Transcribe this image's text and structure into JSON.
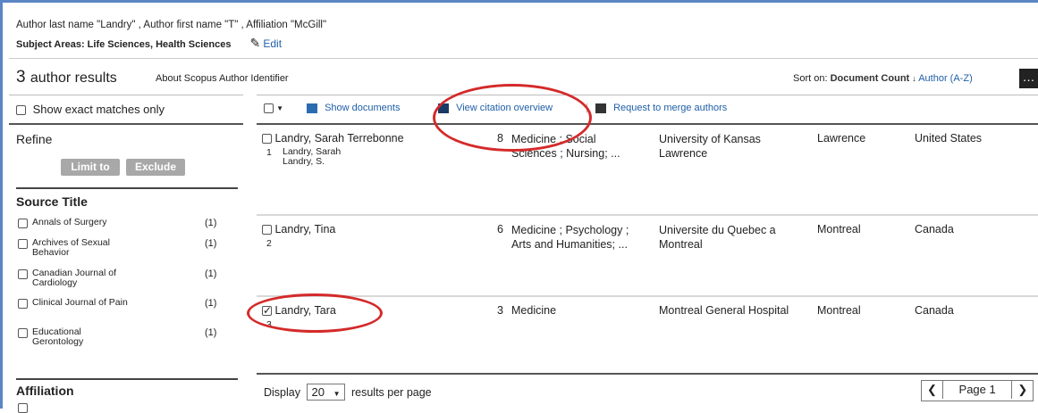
{
  "query": {
    "line1": "Author last name \"Landry\" , Author first name \"T\" , Affiliation \"McGill\"",
    "line2": "Subject Areas: Life Sciences, Health Sciences",
    "edit_label": "Edit"
  },
  "results_header": {
    "count": "3",
    "count_label": "author results",
    "about_link": "About Scopus Author Identifier",
    "sort_label": "Sort on:",
    "sort_value": "Document Count",
    "sort_alt": "Author (A-Z)"
  },
  "sidebar": {
    "exact_matches": "Show exact matches only",
    "refine": "Refine",
    "limit_to": "Limit to",
    "exclude": "Exclude",
    "source_title_heading": "Source Title",
    "source_titles": [
      {
        "name": "Annals of Surgery",
        "count": "(1)"
      },
      {
        "name": "Archives of Sexual Behavior",
        "count": "(1)"
      },
      {
        "name": "Canadian Journal of Cardiology",
        "count": "(1)"
      },
      {
        "name": "Clinical Journal of Pain",
        "count": "(1)"
      },
      {
        "name": "Educational Gerontology",
        "count": "(1)"
      }
    ],
    "affiliation_heading": "Affiliation"
  },
  "toolbar": {
    "show_documents": "Show documents",
    "view_citation_overview": "View citation overview",
    "request_merge": "Request to merge authors"
  },
  "results": [
    {
      "num": "1",
      "name": "Landry, Sarah Terrebonne",
      "variants": [
        "Landry, Sarah",
        "Landry, S."
      ],
      "docs": "8",
      "subjects_l1": "Medicine ; Social",
      "subjects_l2": "Sciences ; Nursing; ...",
      "affiliation_l1": "University of Kansas",
      "affiliation_l2": "Lawrence",
      "city": "Lawrence",
      "country": "United States",
      "checked": false
    },
    {
      "num": "2",
      "name": "Landry, Tina",
      "variants": [],
      "docs": "6",
      "subjects_l1": "Medicine ; Psychology ;",
      "subjects_l2": "Arts and Humanities; ...",
      "affiliation_l1": "Universite du Quebec a",
      "affiliation_l2": "Montreal",
      "city": "Montreal",
      "country": "Canada",
      "checked": false
    },
    {
      "num": "3",
      "name": "Landry, Tara",
      "variants": [],
      "docs": "3",
      "subjects_l1": "Medicine",
      "subjects_l2": "",
      "affiliation_l1": "Montreal General Hospital",
      "affiliation_l2": "",
      "city": "Montreal",
      "country": "Canada",
      "checked": true
    }
  ],
  "footer": {
    "display_label": "Display",
    "per_page_value": "20",
    "per_page_label": "results per page",
    "page_label": "Page 1"
  },
  "colors": {
    "annotation_oval": "#d42a2a",
    "link": "#1f5fa8"
  }
}
